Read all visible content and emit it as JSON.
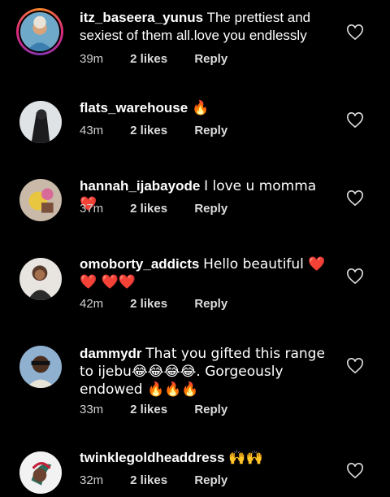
{
  "comments": [
    {
      "username": "itz_baseera_yunus",
      "text": "The prettiest and sexiest of them all.love you endlessly",
      "time": "39m",
      "likes": "2 likes",
      "reply": "Reply"
    },
    {
      "username": "flats_warehouse",
      "text": "🔥",
      "time": "43m",
      "likes": "2 likes",
      "reply": "Reply"
    },
    {
      "username": "hannah_ijabayode",
      "text": "I love u momma❤️",
      "time": "37m",
      "likes": "2 likes",
      "reply": "Reply"
    },
    {
      "username": "omoborty_addicts",
      "text": "Hello beautiful ❤️❤️ ❤️❤️",
      "time": "42m",
      "likes": "2 likes",
      "reply": "Reply"
    },
    {
      "username": "dammydr",
      "text": "That you gifted this range to ijebu😂😂😂😂. Gorgeously endowed 🔥🔥🔥",
      "time": "33m",
      "likes": "2 likes",
      "reply": "Reply"
    },
    {
      "username": "twinklegoldheaddress",
      "text": "🙌🙌",
      "time": "32m",
      "likes": "2 likes",
      "reply": "Reply"
    }
  ],
  "colors": {
    "background": "#000000",
    "text": "#ffffff",
    "meta": "#cfcfcf",
    "story_ring": "#dd2a7b"
  },
  "icons": {
    "like": "heart-outline-icon"
  }
}
